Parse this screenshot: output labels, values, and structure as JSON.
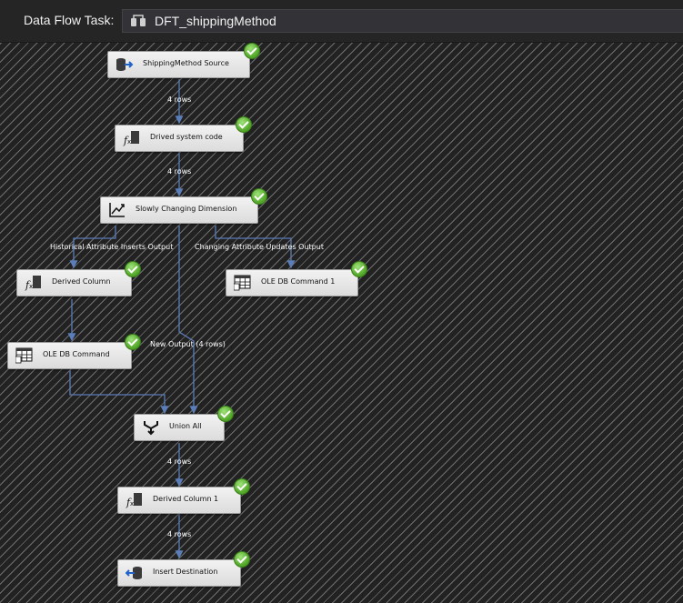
{
  "toolbar": {
    "task_label": "Data Flow Task:",
    "selected_task": "DFT_shippingMethod",
    "selected_task_icon": "data-flow-icon"
  },
  "colors": {
    "canvas_bg": "#222222",
    "stripe": "#6f6f6f",
    "edge": "#5b7db8",
    "status_ok": "#4ea324"
  },
  "nodes": [
    {
      "id": "shippingmethod-source",
      "label": "ShippingMethod Source",
      "icon": "ole-db-source-icon",
      "status": "success"
    },
    {
      "id": "drived-system-code",
      "label": "Drived system code",
      "icon": "derived-column-icon",
      "status": "success"
    },
    {
      "id": "slowly-changing-dimension",
      "label": "Slowly Changing Dimension",
      "icon": "slowly-changing-dimension-icon",
      "status": "success"
    },
    {
      "id": "derived-column",
      "label": "Derived Column",
      "icon": "derived-column-icon",
      "status": "success"
    },
    {
      "id": "ole-db-command-1",
      "label": "OLE DB Command 1",
      "icon": "ole-db-command-icon",
      "status": "success"
    },
    {
      "id": "ole-db-command",
      "label": "OLE DB Command",
      "icon": "ole-db-command-icon",
      "status": "success"
    },
    {
      "id": "union-all",
      "label": "Union All",
      "icon": "union-all-icon",
      "status": "success"
    },
    {
      "id": "derived-column-1",
      "label": "Derived Column 1",
      "icon": "derived-column-icon",
      "status": "success"
    },
    {
      "id": "insert-destination",
      "label": "Insert Destination",
      "icon": "ole-db-destination-icon",
      "status": "success"
    }
  ],
  "paths": [
    {
      "from": "shippingmethod-source",
      "to": "drived-system-code",
      "label": "4 rows"
    },
    {
      "from": "drived-system-code",
      "to": "slowly-changing-dimension",
      "label": "4 rows"
    },
    {
      "from": "slowly-changing-dimension",
      "to": "derived-column",
      "label": "Historical Attribute Inserts Output"
    },
    {
      "from": "slowly-changing-dimension",
      "to": "ole-db-command-1",
      "label": "Changing Attribute Updates Output"
    },
    {
      "from": "slowly-changing-dimension",
      "to": "union-all",
      "label": "New Output (4 rows)"
    },
    {
      "from": "derived-column",
      "to": "ole-db-command",
      "label": ""
    },
    {
      "from": "ole-db-command",
      "to": "union-all",
      "label": ""
    },
    {
      "from": "union-all",
      "to": "derived-column-1",
      "label": "4 rows"
    },
    {
      "from": "derived-column-1",
      "to": "insert-destination",
      "label": "4 rows"
    }
  ]
}
